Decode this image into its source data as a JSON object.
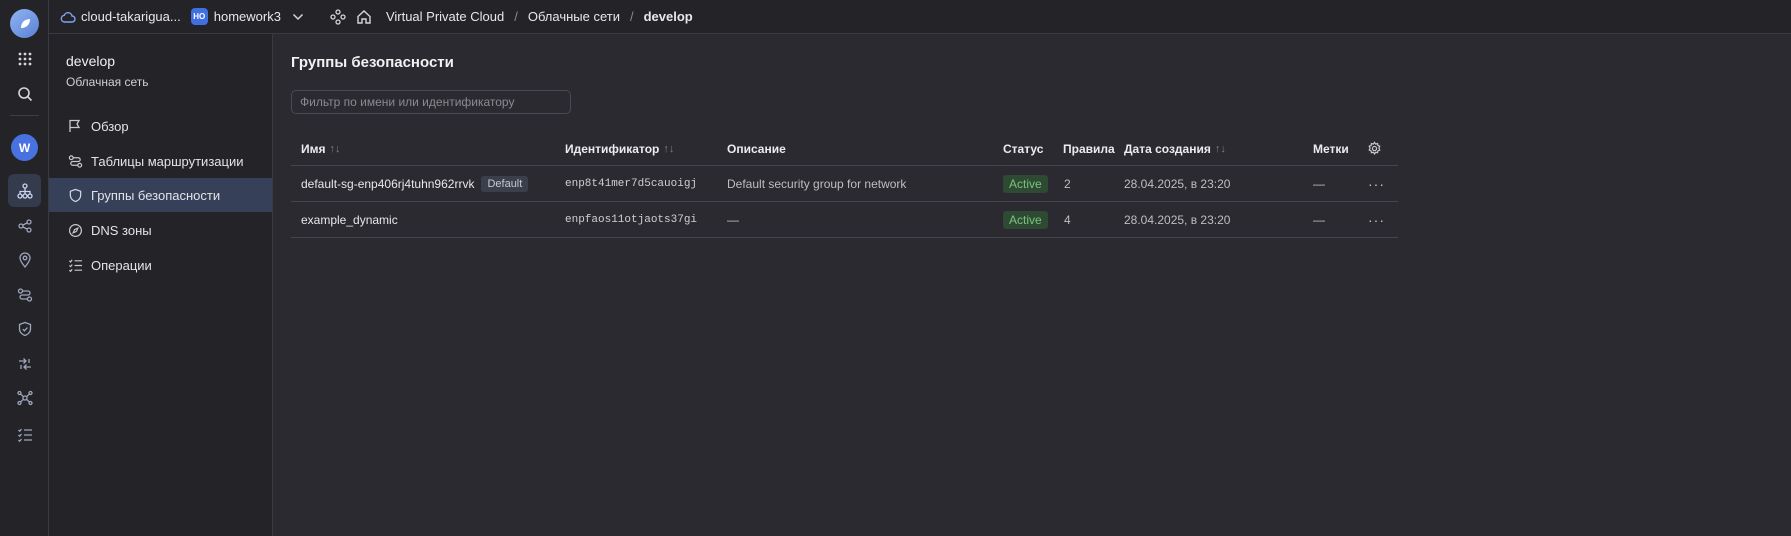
{
  "topbar": {
    "cloud_name": "cloud-takarigua...",
    "folder_badge": "НО",
    "folder_name": "homework3",
    "breadcrumbs": [
      "Virtual Private Cloud",
      "Облачные сети",
      "develop"
    ],
    "separator": "/"
  },
  "sidebar": {
    "title": "develop",
    "subtitle": "Облачная сеть",
    "items": [
      {
        "label": "Обзор",
        "icon": "flag-icon"
      },
      {
        "label": "Таблицы маршрутизации",
        "icon": "route-icon"
      },
      {
        "label": "Группы безопасности",
        "icon": "shield-icon"
      },
      {
        "label": "DNS зоны",
        "icon": "compass-icon"
      },
      {
        "label": "Операции",
        "icon": "list-check-icon"
      }
    ]
  },
  "rail": {
    "account_initial": "W",
    "icons": [
      "grid-icon",
      "search-icon",
      "network-icon",
      "share-icon",
      "location-icon",
      "route-icon",
      "shield-icon",
      "arrows-icon",
      "hub-icon",
      "list-check-icon"
    ]
  },
  "main": {
    "title": "Группы безопасности",
    "filter_placeholder": "Фильтр по имени или идентификатору",
    "filter_value": "",
    "columns": {
      "name": "Имя",
      "id": "Идентификатор",
      "description": "Описание",
      "status": "Статус",
      "rules": "Правила",
      "created": "Дата создания",
      "labels": "Метки"
    },
    "sort_glyph": "↑↓",
    "rows": [
      {
        "name": "default-sg-enp406rj4tuhn962rrvk",
        "tag": "Default",
        "id": "enp8t41mer7d5cauoigj",
        "description": "Default security group for network",
        "status": "Active",
        "rules": "2",
        "created": "28.04.2025, в 23:20",
        "labels": "—",
        "actions": "···"
      },
      {
        "name": "example_dynamic",
        "tag": "",
        "id": "enpfaos11otjaots37gi",
        "description": "—",
        "status": "Active",
        "rules": "4",
        "created": "28.04.2025, в 23:20",
        "labels": "—",
        "actions": "···"
      }
    ]
  },
  "colors": {
    "background": "#2a2a30",
    "panel": "#232328",
    "accent": "#4872e0",
    "active_item": "#364058",
    "status_green": "#7bc37c"
  }
}
